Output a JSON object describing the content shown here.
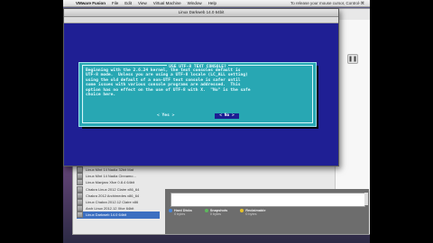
{
  "menubar": {
    "app": "VMware Fusion",
    "items": [
      "File",
      "Edit",
      "View",
      "Virtual Machine",
      "Window",
      "Help"
    ],
    "status": "To release your mouse cursor, Control-⌘"
  },
  "vm_window": {
    "title": "Linux Darkweb 14.0 64bit"
  },
  "dialog": {
    "title": "USE UTF-8 TEXT CONSOLE?",
    "lines": [
      "Beginning with the 2.6.24 kernel, the text consoles default is",
      "UTF-8 mode.  Unless you are using a UTF-8 locale (LC_ALL setting)",
      "using the old default of a non-UTF text console is safer until",
      "some issues with various console programs are addressed.  This",
      "option has no effect on the use of UTF-8 with X.  \"No\" is the safe",
      "choice here."
    ],
    "yes_label": "< Yes >",
    "no_label": "< No >"
  },
  "library": {
    "vm_items": [
      "Linux Mint 14 Nadia 32bit Mat",
      "Linux Mint 14 Nadia Cinnamo...",
      "Linux Manjaro Xfce 0.8.4 64bit",
      "Chakra Linux 2012 Claire x86_64",
      "Chakra 2012 Archimedes x86_64",
      "Linux Chakra 2012.12 Claire x86",
      "Arch Linux 2012.12 Xfce 64bit",
      "Linux Darkweb 14.0 64bit"
    ],
    "selected_index": 7,
    "legend": [
      {
        "label": "Hard Disks",
        "sub": "0 bytes",
        "color": "#4a86d8"
      },
      {
        "label": "Snapshots",
        "sub": "0 bytes",
        "color": "#5cb85c"
      },
      {
        "label": "Reclaimable",
        "sub": "0 bytes",
        "color": "#e6c229"
      }
    ],
    "pause_glyph": "❚❚"
  }
}
